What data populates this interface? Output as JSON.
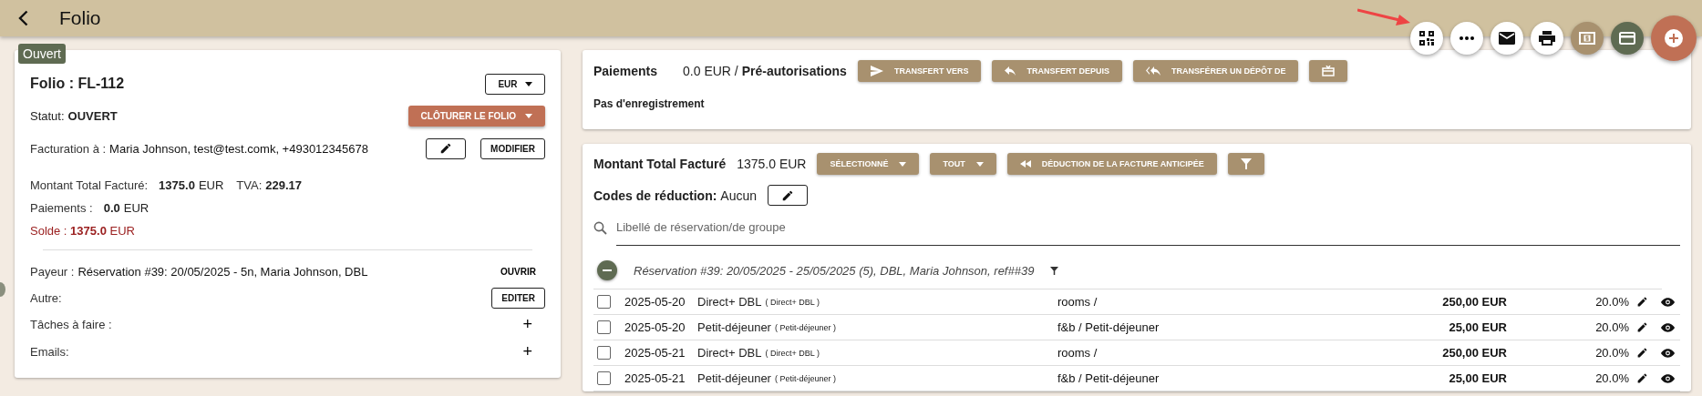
{
  "header": {
    "title": "Folio"
  },
  "actions": [
    {
      "kind": "qr"
    },
    {
      "kind": "more"
    },
    {
      "kind": "mail"
    },
    {
      "kind": "print"
    },
    {
      "kind": "cash"
    },
    {
      "kind": "card"
    },
    {
      "kind": "add"
    }
  ],
  "folio": {
    "badge": "Ouvert",
    "title": "Folio : FL-112",
    "currency": "EUR",
    "status_label": "Statut:",
    "status_value": "OUVERT",
    "close_button": "CLÔTURER LE FOLIO",
    "billing_label": "Facturation à :",
    "billing_value": "Maria Johnson, test@test.comk, +493012345678",
    "modify_button": "MODIFIER",
    "total_label": "Montant Total Facturé:",
    "total_value": "1375.0",
    "total_currency": "EUR",
    "tva_label": "TVA:",
    "tva_value": "229.17",
    "payments_label": "Paiements :",
    "payments_value": "0.0",
    "payments_currency": "EUR",
    "balance": "Solde : **1375.0** EUR",
    "payer_label": "Payeur :",
    "payer_value": "Réservation #39: 20/05/2025 - 5n, Maria Johnson, DBL",
    "open_button": "OUVRIR",
    "other_label": "Autre:",
    "edit_button": "EDITER",
    "tasks_label": "Tâches à faire :",
    "tasks_add": "+",
    "emails_label": "Emails:",
    "emails_add": "+"
  },
  "payments": {
    "title": "Paiements",
    "amount": "0.0 EUR /",
    "preauth": "Pré-autorisations",
    "buttons": [
      {
        "kind": "send",
        "label": "TRANSFERT VERS"
      },
      {
        "kind": "reply",
        "label": "TRANSFERT DEPUIS"
      },
      {
        "kind": "reply-all",
        "label": "TRANSFÉRER UN DÉPÔT DE"
      },
      {
        "kind": "box"
      }
    ],
    "empty": "Pas d'enregistrement"
  },
  "billing": {
    "title": "Montant Total Facturé",
    "amount": "1375.0 EUR",
    "buttons": [
      {
        "kind": "dropdown",
        "label": "SÉLECTIONNÉ"
      },
      {
        "kind": "dropdown",
        "label": "TOUT"
      },
      {
        "kind": "rewind",
        "label": "DÉDUCTION DE LA FACTURE ANTICIPÉE"
      },
      {
        "kind": "filter"
      }
    ],
    "discount_label": "Codes de réduction:",
    "discount_value": "Aucun",
    "search": {
      "placeholder": "Libellé de réservation/de groupe"
    },
    "group": {
      "label": "Réservation #39: 20/05/2025 - 25/05/2025 (5), DBL, Maria Johnson, ref##39",
      "expanded": true
    },
    "rows": [
      {
        "checked": false,
        "date": "2025-05-20",
        "name": "Direct+ DBL",
        "sub": "( Direct+ DBL )",
        "category": "rooms /",
        "amount": "250,00 EUR",
        "tax": "20.0%"
      },
      {
        "checked": false,
        "date": "2025-05-20",
        "name": "Petit-déjeuner",
        "sub": "( Petit-déjeuner )",
        "category": "f&b / Petit-déjeuner",
        "amount": "25,00 EUR",
        "tax": "20.0%"
      },
      {
        "checked": false,
        "date": "2025-05-21",
        "name": "Direct+ DBL",
        "sub": "( Direct+ DBL )",
        "category": "rooms /",
        "amount": "250,00 EUR",
        "tax": "20.0%"
      },
      {
        "checked": false,
        "date": "2025-05-21",
        "name": "Petit-déjeuner",
        "sub": "( Petit-déjeuner )",
        "category": "f&b / Petit-déjeuner",
        "amount": "25,00 EUR",
        "tax": "20.0%"
      }
    ]
  }
}
